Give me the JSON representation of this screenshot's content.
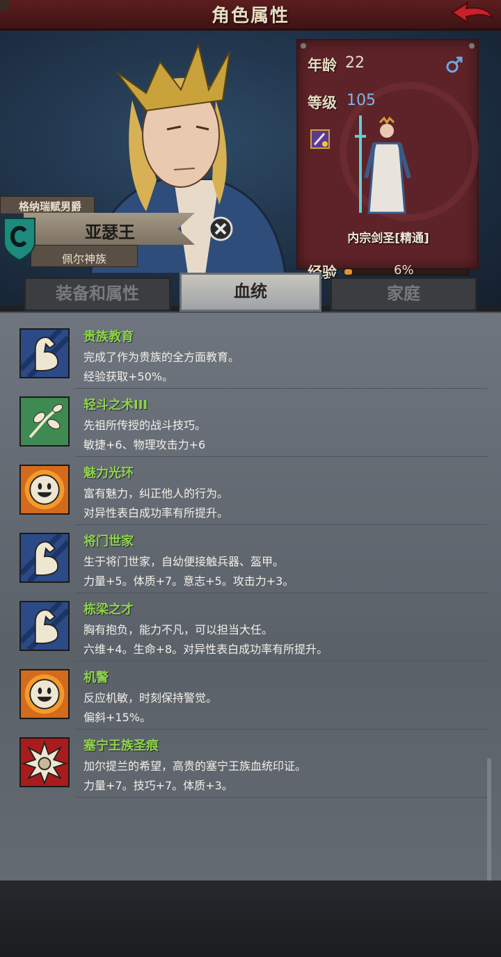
{
  "header": {
    "title": "角色属性",
    "back_icon": "back-arrow-icon"
  },
  "character": {
    "title": "格纳瑞赋男爵",
    "name": "亚瑟王",
    "race": "佩尔神族",
    "crest_icon": "crest-shield-icon"
  },
  "stats": {
    "age_label": "年龄",
    "age": "22",
    "gender_icon": "male-icon",
    "level_label": "等级",
    "level": "105",
    "class_name": "内宗剑圣[精通]",
    "exp_label": "经验",
    "exp_text": "6%",
    "exp_fraction": 0.06
  },
  "tabs": [
    {
      "label": "装备和属性",
      "active": false
    },
    {
      "label": "血统",
      "active": true
    },
    {
      "label": "家庭",
      "active": false
    }
  ],
  "traits": [
    {
      "icon": "arm-strength-icon",
      "name": "贵族教育",
      "desc": "完成了作为贵族的全方面教育。",
      "bonus": "经验获取+50%。"
    },
    {
      "icon": "branch-icon",
      "name": "轻斗之术III",
      "desc": "先祖所传授的战斗技巧。",
      "bonus": "敏捷+6、物理攻击力+6"
    },
    {
      "icon": "sun-face-icon",
      "name": "魅力光环",
      "desc": "富有魅力，纠正他人的行为。",
      "bonus": "对异性表白成功率有所提升。"
    },
    {
      "icon": "arm-strength-icon",
      "name": "将门世家",
      "desc": "生于将门世家，自幼便接触兵器、盔甲。",
      "bonus": "力量+5。体质+7。意志+5。攻击力+3。"
    },
    {
      "icon": "arm-strength-icon",
      "name": "栋梁之才",
      "desc": "胸有抱负，能力不凡，可以担当大任。",
      "bonus": "六维+4。生命+8。对异性表白成功率有所提升。"
    },
    {
      "icon": "sun-face-icon",
      "name": "机警",
      "desc": "反应机敏，时刻保持警觉。",
      "bonus": "偏斜+15%。"
    },
    {
      "icon": "royal-seal-icon",
      "name": "塞宁王族圣痕",
      "desc": "加尔提兰的希望，高贵的塞宁王族血统印证。",
      "bonus": "力量+7。技巧+7。体质+3。"
    }
  ]
}
